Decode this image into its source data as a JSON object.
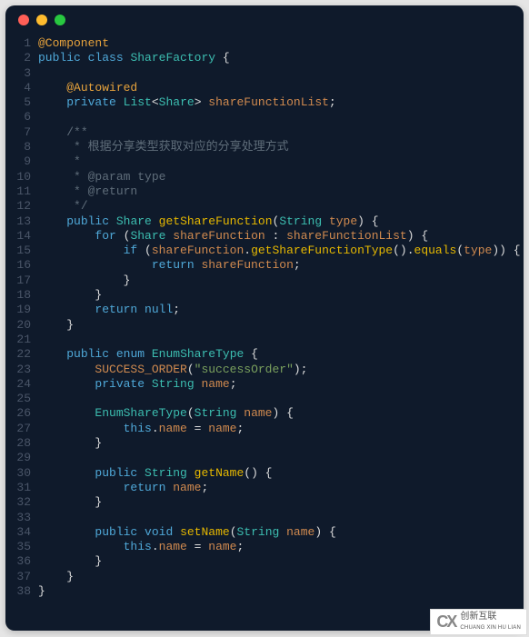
{
  "code": {
    "lines": [
      [
        [
          "tok-annotation",
          "@Component"
        ]
      ],
      [
        [
          "tok-keyword",
          "public"
        ],
        [
          "tok-punc",
          " "
        ],
        [
          "tok-keyword",
          "class"
        ],
        [
          "tok-punc",
          " "
        ],
        [
          "tok-type",
          "ShareFactory"
        ],
        [
          "tok-punc",
          " {"
        ]
      ],
      [],
      [
        [
          "tok-punc",
          "    "
        ],
        [
          "tok-annotation",
          "@Autowired"
        ]
      ],
      [
        [
          "tok-punc",
          "    "
        ],
        [
          "tok-keyword",
          "private"
        ],
        [
          "tok-punc",
          " "
        ],
        [
          "tok-type",
          "List"
        ],
        [
          "tok-punc",
          "<"
        ],
        [
          "tok-type",
          "Share"
        ],
        [
          "tok-punc",
          "> "
        ],
        [
          "tok-param",
          "shareFunctionList"
        ],
        [
          "tok-punc",
          ";"
        ]
      ],
      [],
      [
        [
          "tok-punc",
          "    "
        ],
        [
          "tok-comment",
          "/**"
        ]
      ],
      [
        [
          "tok-punc",
          "    "
        ],
        [
          "tok-comment",
          " * 根据分享类型获取对应的分享处理方式"
        ]
      ],
      [
        [
          "tok-punc",
          "    "
        ],
        [
          "tok-comment",
          " *"
        ]
      ],
      [
        [
          "tok-punc",
          "    "
        ],
        [
          "tok-comment",
          " * @param type"
        ]
      ],
      [
        [
          "tok-punc",
          "    "
        ],
        [
          "tok-comment",
          " * @return"
        ]
      ],
      [
        [
          "tok-punc",
          "    "
        ],
        [
          "tok-comment",
          " */"
        ]
      ],
      [
        [
          "tok-punc",
          "    "
        ],
        [
          "tok-keyword",
          "public"
        ],
        [
          "tok-punc",
          " "
        ],
        [
          "tok-type",
          "Share"
        ],
        [
          "tok-punc",
          " "
        ],
        [
          "tok-method",
          "getShareFunction"
        ],
        [
          "tok-punc",
          "("
        ],
        [
          "tok-type",
          "String"
        ],
        [
          "tok-punc",
          " "
        ],
        [
          "tok-param",
          "type"
        ],
        [
          "tok-punc",
          ") {"
        ]
      ],
      [
        [
          "tok-punc",
          "        "
        ],
        [
          "tok-keyword",
          "for"
        ],
        [
          "tok-punc",
          " ("
        ],
        [
          "tok-type",
          "Share"
        ],
        [
          "tok-punc",
          " "
        ],
        [
          "tok-param",
          "shareFunction"
        ],
        [
          "tok-punc",
          " : "
        ],
        [
          "tok-param",
          "shareFunctionList"
        ],
        [
          "tok-punc",
          ") {"
        ]
      ],
      [
        [
          "tok-punc",
          "            "
        ],
        [
          "tok-keyword",
          "if"
        ],
        [
          "tok-punc",
          " ("
        ],
        [
          "tok-param",
          "shareFunction"
        ],
        [
          "tok-punc",
          "."
        ],
        [
          "tok-method",
          "getShareFunctionType"
        ],
        [
          "tok-punc",
          "()."
        ],
        [
          "tok-method",
          "equals"
        ],
        [
          "tok-punc",
          "("
        ],
        [
          "tok-param",
          "type"
        ],
        [
          "tok-punc",
          ")) {"
        ]
      ],
      [
        [
          "tok-punc",
          "                "
        ],
        [
          "tok-keyword",
          "return"
        ],
        [
          "tok-punc",
          " "
        ],
        [
          "tok-param",
          "shareFunction"
        ],
        [
          "tok-punc",
          ";"
        ]
      ],
      [
        [
          "tok-punc",
          "            }"
        ]
      ],
      [
        [
          "tok-punc",
          "        }"
        ]
      ],
      [
        [
          "tok-punc",
          "        "
        ],
        [
          "tok-keyword",
          "return"
        ],
        [
          "tok-punc",
          " "
        ],
        [
          "tok-keyword",
          "null"
        ],
        [
          "tok-punc",
          ";"
        ]
      ],
      [
        [
          "tok-punc",
          "    }"
        ]
      ],
      [],
      [
        [
          "tok-punc",
          "    "
        ],
        [
          "tok-keyword",
          "public"
        ],
        [
          "tok-punc",
          " "
        ],
        [
          "tok-keyword",
          "enum"
        ],
        [
          "tok-punc",
          " "
        ],
        [
          "tok-type",
          "EnumShareType"
        ],
        [
          "tok-punc",
          " {"
        ]
      ],
      [
        [
          "tok-punc",
          "        "
        ],
        [
          "tok-param",
          "SUCCESS_ORDER"
        ],
        [
          "tok-punc",
          "("
        ],
        [
          "tok-string",
          "\"successOrder\""
        ],
        [
          "tok-punc",
          ");"
        ]
      ],
      [
        [
          "tok-punc",
          "        "
        ],
        [
          "tok-keyword",
          "private"
        ],
        [
          "tok-punc",
          " "
        ],
        [
          "tok-type",
          "String"
        ],
        [
          "tok-punc",
          " "
        ],
        [
          "tok-param",
          "name"
        ],
        [
          "tok-punc",
          ";"
        ]
      ],
      [],
      [
        [
          "tok-punc",
          "        "
        ],
        [
          "tok-type",
          "EnumShareType"
        ],
        [
          "tok-punc",
          "("
        ],
        [
          "tok-type",
          "String"
        ],
        [
          "tok-punc",
          " "
        ],
        [
          "tok-param",
          "name"
        ],
        [
          "tok-punc",
          ") {"
        ]
      ],
      [
        [
          "tok-punc",
          "            "
        ],
        [
          "tok-keyword",
          "this"
        ],
        [
          "tok-punc",
          "."
        ],
        [
          "tok-param",
          "name"
        ],
        [
          "tok-punc",
          " = "
        ],
        [
          "tok-param",
          "name"
        ],
        [
          "tok-punc",
          ";"
        ]
      ],
      [
        [
          "tok-punc",
          "        }"
        ]
      ],
      [],
      [
        [
          "tok-punc",
          "        "
        ],
        [
          "tok-keyword",
          "public"
        ],
        [
          "tok-punc",
          " "
        ],
        [
          "tok-type",
          "String"
        ],
        [
          "tok-punc",
          " "
        ],
        [
          "tok-method",
          "getName"
        ],
        [
          "tok-punc",
          "() {"
        ]
      ],
      [
        [
          "tok-punc",
          "            "
        ],
        [
          "tok-keyword",
          "return"
        ],
        [
          "tok-punc",
          " "
        ],
        [
          "tok-param",
          "name"
        ],
        [
          "tok-punc",
          ";"
        ]
      ],
      [
        [
          "tok-punc",
          "        }"
        ]
      ],
      [],
      [
        [
          "tok-punc",
          "        "
        ],
        [
          "tok-keyword",
          "public"
        ],
        [
          "tok-punc",
          " "
        ],
        [
          "tok-keyword",
          "void"
        ],
        [
          "tok-punc",
          " "
        ],
        [
          "tok-method",
          "setName"
        ],
        [
          "tok-punc",
          "("
        ],
        [
          "tok-type",
          "String"
        ],
        [
          "tok-punc",
          " "
        ],
        [
          "tok-param",
          "name"
        ],
        [
          "tok-punc",
          ") {"
        ]
      ],
      [
        [
          "tok-punc",
          "            "
        ],
        [
          "tok-keyword",
          "this"
        ],
        [
          "tok-punc",
          "."
        ],
        [
          "tok-param",
          "name"
        ],
        [
          "tok-punc",
          " = "
        ],
        [
          "tok-param",
          "name"
        ],
        [
          "tok-punc",
          ";"
        ]
      ],
      [
        [
          "tok-punc",
          "        }"
        ]
      ],
      [
        [
          "tok-punc",
          "    }"
        ]
      ],
      [
        [
          "tok-punc",
          "}"
        ]
      ]
    ]
  },
  "watermark": {
    "logo": "CX",
    "line1": "创新互联",
    "line2": "CHUANG XIN HU LIAN"
  }
}
